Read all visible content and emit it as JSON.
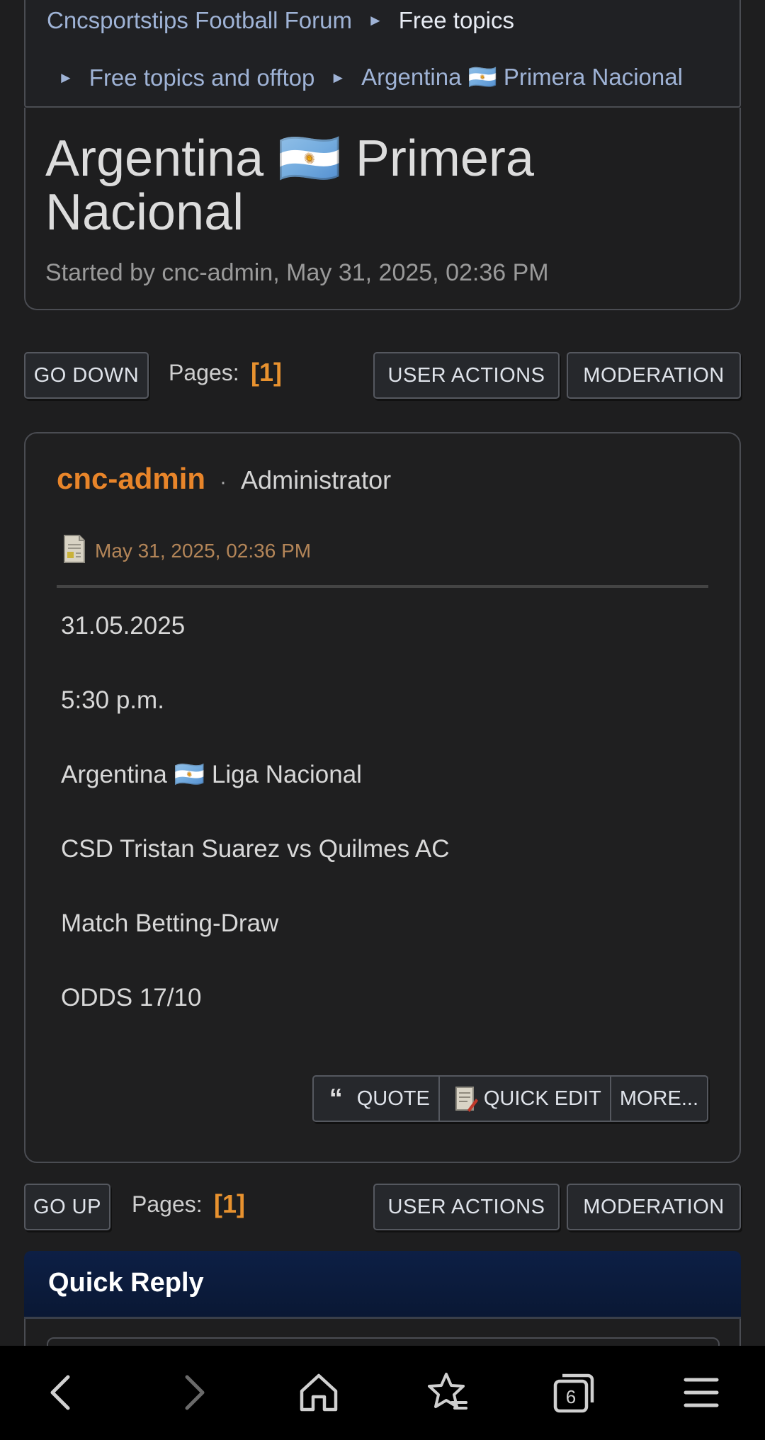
{
  "breadcrumb": {
    "items": [
      "Cncsportstips Football Forum",
      "Free topics",
      "Free topics and offtop",
      "Argentina 🇦🇷 Primera Nacional"
    ],
    "separator": "►"
  },
  "topic": {
    "title": "Argentina 🇦🇷 Primera Nacional",
    "started_by": "Started by cnc-admin, May 31, 2025, 02:36 PM"
  },
  "top_bar": {
    "go_label": "GO DOWN",
    "pages_label": "Pages:",
    "pages_value": "[1]",
    "user_actions": "USER ACTIONS",
    "moderation": "MODERATION"
  },
  "bottom_bar": {
    "go_label": "GO UP",
    "pages_label": "Pages:",
    "pages_value": "[1]",
    "user_actions": "USER ACTIONS",
    "moderation": "MODERATION"
  },
  "post": {
    "author": "cnc-admin",
    "role": "Administrator",
    "date": "May 31, 2025, 02:36 PM",
    "lines": [
      "31.05.2025",
      "5:30 p.m.",
      "Argentina 🇦🇷 Liga Nacional",
      "CSD Tristan Suarez vs Quilmes AC",
      "Match Betting-Draw",
      "ODDS 17/10"
    ],
    "actions": {
      "quote": "QUOTE",
      "quick_edit": "QUICK EDIT",
      "more": "MORE..."
    }
  },
  "quick_reply": {
    "title": "Quick Reply"
  },
  "browser_nav": {
    "tabs_count": "6",
    "icons": [
      "back-icon",
      "forward-icon",
      "home-icon",
      "bookmarks-icon",
      "tabs-icon",
      "menu-icon"
    ]
  },
  "colors": {
    "accent_orange": "#e8852a",
    "link_blue": "#9fb3d6",
    "quick_reply_bg": "#0d1f45"
  }
}
